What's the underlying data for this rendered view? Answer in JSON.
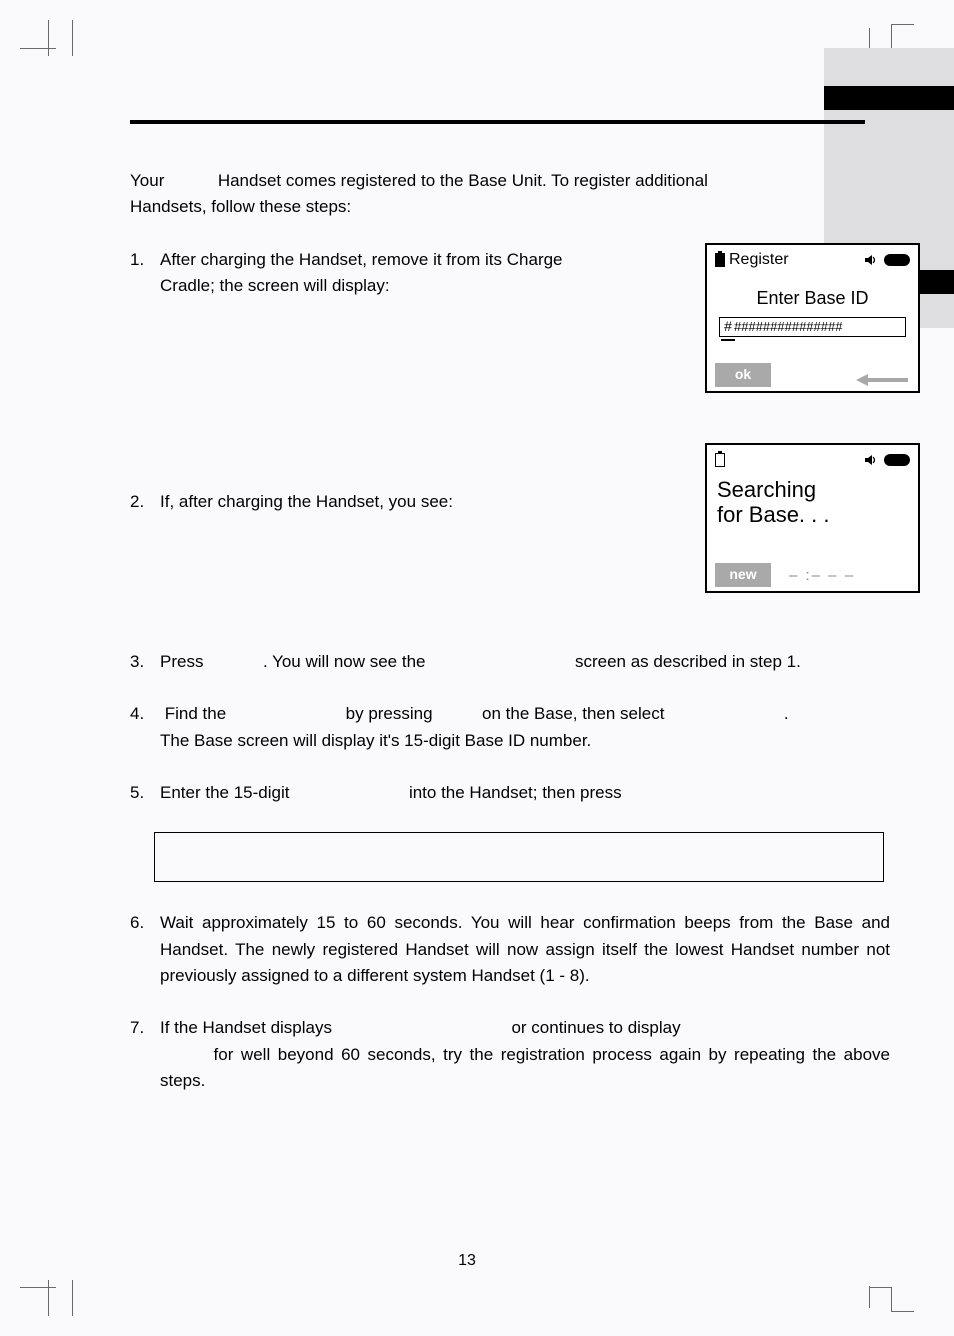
{
  "intro": {
    "line1_prefix": "Your",
    "line1_suffix": "Handset comes registered to the Base Unit. To register additional",
    "line2": "Handsets, follow these steps:"
  },
  "steps": {
    "s1": "After charging the Handset, remove it from its Charge Cradle; the screen will display:",
    "s2": "If, after charging the Handset, you see:",
    "s3_a": "Press",
    "s3_b": ". You will now see the",
    "s3_c": "screen as described in step 1.",
    "s4_a": "Find the",
    "s4_b": "by pressing",
    "s4_c": "on the Base, then select",
    "s4_d": ".",
    "s4_line2": "The Base screen will display it's 15-digit Base ID number.",
    "s5_a": "Enter the 15-digit",
    "s5_b": "into the Handset; then press",
    "s6": "Wait  approximately 15 to 60 seconds. You will hear confirmation beeps from the Base and Handset. The newly registered Handset will now assign itself the lowest Handset number not previously assigned to a different system Handset (1 - 8).",
    "s7_a": "If the Handset displays",
    "s7_b": "or continues to display",
    "s7_c": "for well beyond 60 seconds, try the registration process again by repeating the above steps."
  },
  "lcd1": {
    "title": "Register",
    "enter": "Enter Base ID",
    "hash_first": "#",
    "hash_rest": "###############",
    "ok": "ok"
  },
  "lcd2": {
    "line1": "Searching",
    "line2": "for Base. . .",
    "new": "new",
    "time": "– :– – –"
  },
  "page_number": "13"
}
